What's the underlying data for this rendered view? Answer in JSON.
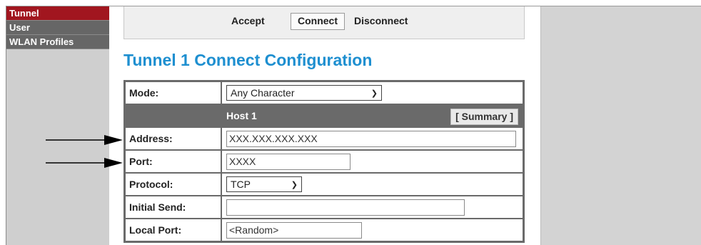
{
  "sidebar": {
    "items": [
      {
        "label": "Tunnel",
        "active": true
      },
      {
        "label": "User",
        "active": false
      },
      {
        "label": "WLAN Profiles",
        "active": false
      }
    ]
  },
  "toolbar": {
    "accept_label": "Accept",
    "connect_label": "Connect",
    "disconnect_label": "Disconnect"
  },
  "page": {
    "title": "Tunnel 1 Connect Configuration"
  },
  "config": {
    "mode_label": "Mode:",
    "mode_value": "Any Character",
    "host_label": "Host 1",
    "summary_label": "[ Summary ]",
    "address_label": "Address:",
    "address_value": "XXX.XXX.XXX.XXX",
    "port_label": "Port:",
    "port_value": "XXXX",
    "protocol_label": "Protocol:",
    "protocol_value": "TCP",
    "initial_send_label": "Initial Send:",
    "initial_send_value": "",
    "local_port_label": "Local Port:",
    "local_port_value": "<Random>"
  },
  "colors": {
    "active_nav": "#a1161f",
    "nav": "#666666",
    "title": "#1e8fd0",
    "table_border": "#6a6a6a"
  },
  "icons": [
    "chevron-down-icon",
    "arrow-right-icon"
  ]
}
